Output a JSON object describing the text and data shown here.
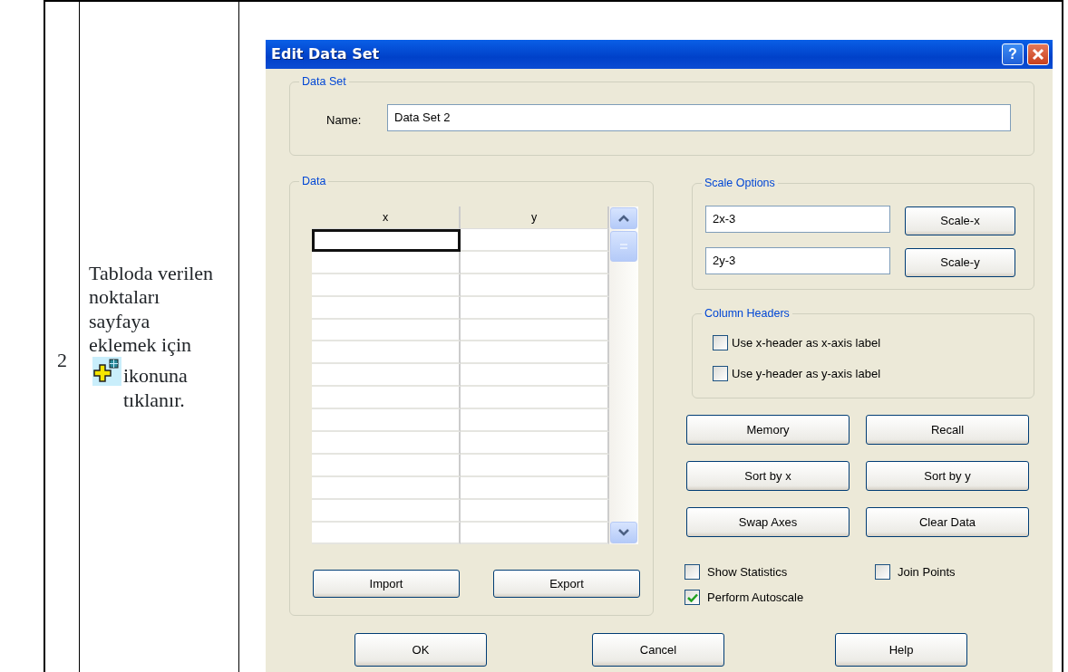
{
  "doc_row": {
    "number": "2",
    "text_before": "Tabloda verilen noktaları sayfaya eklemek için",
    "text_after": "ikonuna tıklanır."
  },
  "dialog": {
    "title": "Edit Data Set",
    "help_glyph": "?",
    "data_set": {
      "legend": "Data Set",
      "name_label": "Name:",
      "name_value": "Data Set 2"
    },
    "data": {
      "legend": "Data",
      "columns": [
        "x",
        "y"
      ],
      "rows": [
        {
          "selected": true
        },
        {
          "selected": false
        },
        {
          "selected": false
        },
        {
          "selected": false
        },
        {
          "selected": false
        },
        {
          "selected": false
        },
        {
          "selected": false
        },
        {
          "selected": false
        },
        {
          "selected": false
        },
        {
          "selected": false
        },
        {
          "selected": false
        },
        {
          "selected": false
        },
        {
          "selected": false
        },
        {
          "selected": false
        }
      ],
      "buttons": [
        "Import",
        "Export"
      ]
    },
    "scale_options": {
      "legend": "Scale Options",
      "rows": [
        {
          "value": "2x-3",
          "button": "Scale-x"
        },
        {
          "value": "2y-3",
          "button": "Scale-y"
        }
      ]
    },
    "column_headers": {
      "legend": "Column Headers",
      "options": [
        {
          "label": "Use x-header as x-axis label",
          "checked": false
        },
        {
          "label": "Use y-header as y-axis label",
          "checked": false
        }
      ]
    },
    "action_buttons": [
      "Memory",
      "Recall",
      "Sort by x",
      "Sort by y",
      "Swap Axes",
      "Clear Data"
    ],
    "options": [
      {
        "label": "Show Statistics",
        "checked": false
      },
      {
        "label": "Join Points",
        "checked": false
      },
      {
        "label": "Perform Autoscale",
        "checked": true
      }
    ],
    "footer_buttons": [
      "OK",
      "Cancel",
      "Help"
    ]
  }
}
